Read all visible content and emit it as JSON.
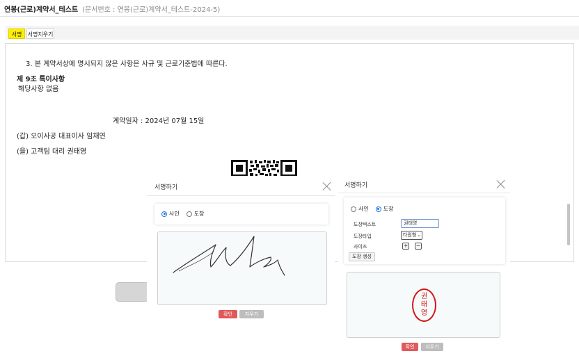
{
  "header": {
    "title": "연봉(근로)계약서_테스트",
    "doc_number": "(문서번호 : 연봉(근로)계약서_테스트-2024-5)"
  },
  "tabs": [
    {
      "label": "서명",
      "active": true
    },
    {
      "label": "서명지우기",
      "active": false
    }
  ],
  "document": {
    "line_clause3": "3. 본 계약서상에 명시되지 않은 사항은 사규 및 근로기준법에 따른다.",
    "article9_title": "제 9조 특이사항",
    "article9_body": "해당사항 없음",
    "contract_date": "계약일자 : 2024년 07월 15일",
    "party_a": "(갑)  오이사공  대표이사  임채연",
    "party_b": "(을)  고객팀  대리  권태영"
  },
  "sign_modal": {
    "title": "서명하기",
    "option_sign": "사인",
    "option_stamp": "도장",
    "selected": "사인",
    "confirm": "확인",
    "clear": "지우기"
  },
  "stamp_modal": {
    "title": "서명하기",
    "option_sign": "사인",
    "option_stamp": "도장",
    "selected": "도장",
    "stamp_text_label": "도장텍스트",
    "stamp_text_value": "권태영",
    "stamp_type_label": "도장타입",
    "stamp_type_value": "타원형",
    "size_label": "사이즈",
    "size_plus": "+",
    "size_minus": "−",
    "generate": "도장 생성",
    "stamp_chars": [
      "권",
      "태",
      "영"
    ],
    "confirm": "확인",
    "clear": "지우기"
  },
  "colors": {
    "tab_active": "#ffee00",
    "radio_on": "#1a73e8",
    "confirm_button": "#e05a5a",
    "stamp_red": "#d01818"
  },
  "icons": {
    "close": "close-icon",
    "qr": "qr-code-icon"
  }
}
